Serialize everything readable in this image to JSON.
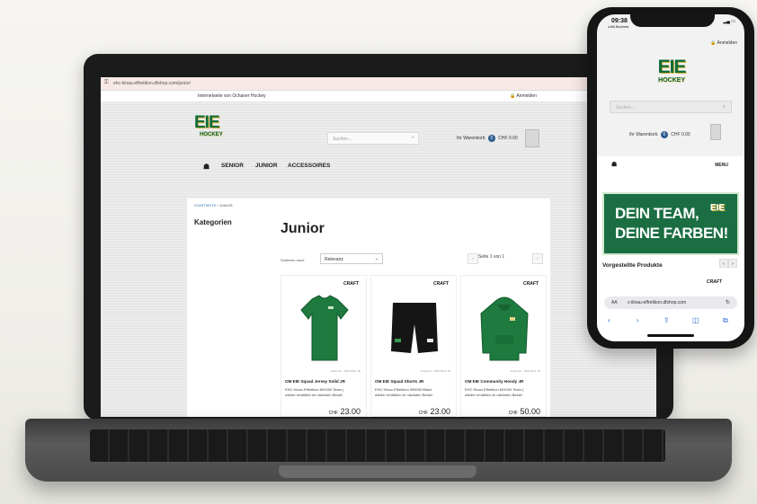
{
  "laptop": {
    "browser": {
      "url": "ehc-kinau-effretikon.dfshop.com/junior/"
    },
    "site": {
      "tagline": "Internetseite von Ochaner Hockey",
      "login": "Anmelden",
      "brand": {
        "main": "EIE",
        "sub": "HOCKEY"
      },
      "search_placeholder": "Suchen...",
      "cart": {
        "label": "Ihr Warenkorb",
        "count": "0",
        "total": "CHF 0.00"
      },
      "nav": [
        "SENIOR",
        "JUNIOR",
        "ACCESSOIRES"
      ],
      "breadcrumb": {
        "home": "STARTSEITE",
        "sep": "/",
        "current": "JUNIOR"
      },
      "sidebar_title": "Kategorien",
      "page_title": "Junior",
      "sort": {
        "label": "Sortieren nach:",
        "value": "Relevanz"
      },
      "pager": "Seite 1 von 1",
      "products": [
        {
          "brand": "CRAFT",
          "art": "Artikel-Nr.: 1909 0001 JR",
          "name": "OM EIE Squad Jersey Solid JR",
          "desc1": "EHC Kinau Effretikon 651000 Team (",
          "desc2": "wieder erhältlich im nächsten Bestel",
          "currency": "CHF",
          "price": "23.00",
          "color": "#1e7a3e"
        },
        {
          "brand": "CRAFT",
          "art": "Artikel-Nr.: 1909 0013 JR",
          "name": "OM EIE Squad Shorts JR",
          "desc1": "EHC Kinau Effretikon 999000 Black",
          "desc2": "wieder erhältlich im nächsten Bestel",
          "currency": "CHF",
          "price": "23.00",
          "color": "#151515"
        },
        {
          "brand": "CRAFT",
          "art": "Artikel-Nr.: 1909 0021 JR",
          "name": "OM EIE Community Hoody JR",
          "desc1": "EHC Kinau Effretikon 651000 Team (",
          "desc2": "wieder erhältlich im nächsten Bestel",
          "currency": "CHF",
          "price": "50.00",
          "color": "#1e7a3e"
        }
      ]
    }
  },
  "phone": {
    "status": {
      "time": "09:38",
      "carrier": "◂ WA Business"
    },
    "login": "Anmelden",
    "brand": {
      "main": "EIE",
      "sub": "HOCKEY"
    },
    "search_placeholder": "Suchen...",
    "cart": {
      "label": "Ihr Warenkorb",
      "count": "0",
      "total": "CHF 0.00"
    },
    "menu": "MENU",
    "banner": {
      "line1": "DEIN TEAM,",
      "line2": "DEINE FARBEN!",
      "mini_logo": "EIE"
    },
    "featured_title": "Vorgestellte Produkte",
    "craft": "CRAFT",
    "url": {
      "aa": "AA",
      "text": "c-ilinau-effretikon.dfshop.com"
    }
  }
}
